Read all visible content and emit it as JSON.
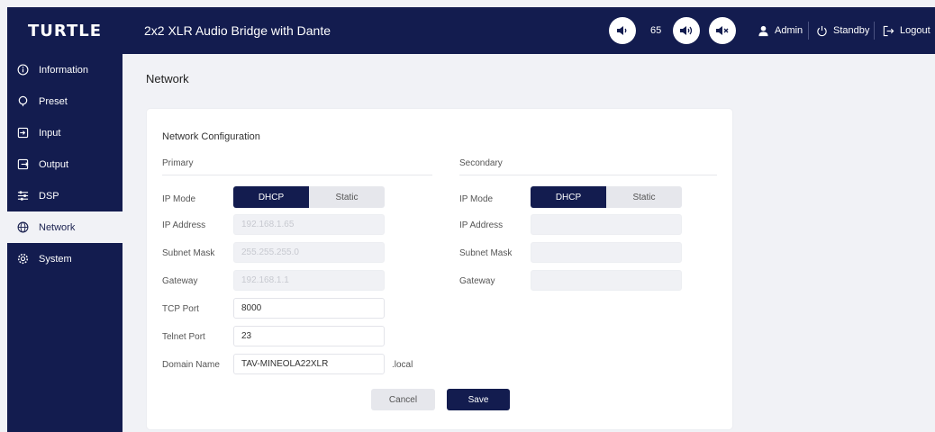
{
  "brand": "TURTLE",
  "header": {
    "title": "2x2 XLR Audio Bridge with Dante",
    "volume": "65",
    "user": "Admin",
    "standby": "Standby",
    "logout": "Logout"
  },
  "sidebar": {
    "items": [
      {
        "label": "Information",
        "icon": "info-icon"
      },
      {
        "label": "Preset",
        "icon": "preset-icon"
      },
      {
        "label": "Input",
        "icon": "input-icon"
      },
      {
        "label": "Output",
        "icon": "output-icon"
      },
      {
        "label": "DSP",
        "icon": "dsp-icon"
      },
      {
        "label": "Network",
        "icon": "globe-icon",
        "active": true
      },
      {
        "label": "System",
        "icon": "gear-icon"
      }
    ]
  },
  "page": {
    "title": "Network"
  },
  "card": {
    "title": "Network Configuration",
    "labels": {
      "ip_mode": "IP Mode",
      "ip_address": "IP Address",
      "subnet_mask": "Subnet Mask",
      "gateway": "Gateway",
      "tcp_port": "TCP Port",
      "telnet_port": "Telnet Port",
      "domain_name": "Domain Name"
    },
    "primary": {
      "heading": "Primary",
      "mode_options": [
        "DHCP",
        "Static"
      ],
      "selected_mode": "DHCP",
      "ip_address": "192.168.1.65",
      "subnet_mask": "255.255.255.0",
      "gateway": "192.168.1.1",
      "tcp_port": "8000",
      "telnet_port": "23",
      "domain_name": "TAV-MINEOLA22XLR",
      "domain_suffix": ".local"
    },
    "secondary": {
      "heading": "Secondary",
      "mode_options": [
        "DHCP",
        "Static"
      ],
      "selected_mode": "DHCP",
      "ip_address": "",
      "subnet_mask": "",
      "gateway": ""
    },
    "buttons": {
      "cancel": "Cancel",
      "save": "Save"
    }
  },
  "colors": {
    "navy": "#131c4f",
    "background": "#f1f2f6",
    "card": "#ffffff"
  }
}
